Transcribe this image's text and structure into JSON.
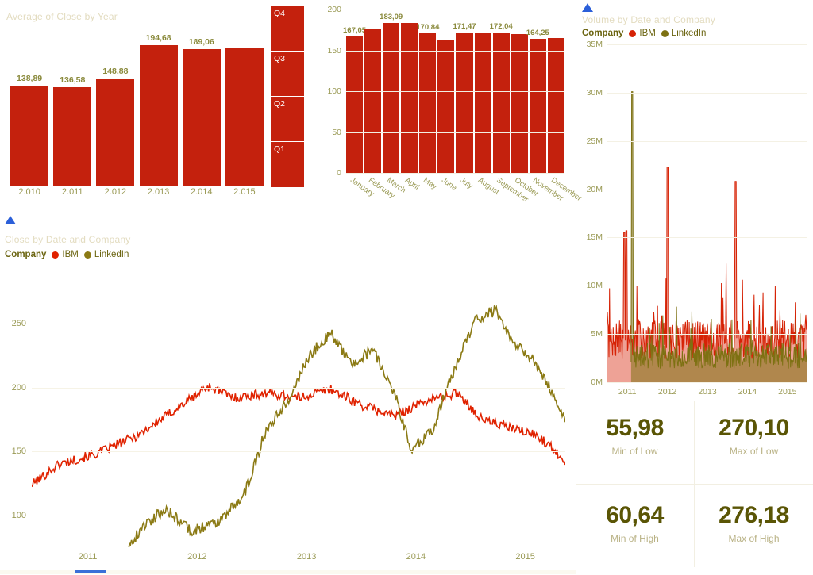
{
  "colors": {
    "ibm_red": "#c4210d",
    "linkedin_olive": "#8b7a14",
    "title_text": "#e3dcc0",
    "axis_text": "#9a9a55",
    "label_text": "#8a8a3c",
    "kpi_value": "#5a5505",
    "kpi_label": "#b9b285",
    "scroll_thumb": "#3a6fd8",
    "filter_arrow": "#2b5fd9"
  },
  "year_chart": {
    "title": "Average of Close by Year",
    "chart_data": {
      "type": "bar",
      "title": "Average of Close by Year",
      "xlabel": "",
      "ylabel": "",
      "categories": [
        "2.010",
        "2.011",
        "2.012",
        "2.013",
        "2.014",
        "2.015"
      ],
      "values": [
        138.89,
        136.58,
        148.88,
        194.68,
        189.06,
        191.5
      ],
      "labels": [
        "138,89",
        "136,58",
        "148,88",
        "194,68",
        "189,06",
        ""
      ],
      "ylim": [
        0,
        220
      ],
      "grid": false
    },
    "quarter_slicer": {
      "segments": [
        "Q4",
        "Q3",
        "Q2",
        "Q1"
      ]
    }
  },
  "month_chart": {
    "chart_data": {
      "type": "bar",
      "title": "",
      "xlabel": "",
      "ylabel": "",
      "categories": [
        "January",
        "February",
        "March",
        "April",
        "May",
        "June",
        "July",
        "August",
        "September",
        "October",
        "November",
        "December"
      ],
      "values": [
        167.05,
        176.5,
        183.09,
        183.2,
        170.84,
        162.5,
        171.47,
        170.6,
        172.04,
        169.8,
        164.25,
        165.0
      ],
      "labels": [
        "167,05",
        "",
        "183,09",
        "",
        "170,84",
        "",
        "171,47",
        "",
        "172,04",
        "",
        "164,25",
        ""
      ],
      "yticks": [
        "0",
        "50",
        "100",
        "150",
        "200"
      ],
      "ylim": [
        0,
        200
      ],
      "grid": true
    }
  },
  "volume_chart": {
    "title": "Volume by Date and Company",
    "legend": {
      "label": "Company",
      "items": [
        {
          "name": "IBM",
          "color": "#d62205"
        },
        {
          "name": "LinkedIn",
          "color": "#7d7112"
        }
      ]
    },
    "chart_data": {
      "type": "area",
      "title": "Volume by Date and Company",
      "xlabel": "",
      "ylabel": "",
      "yticks": [
        "0M",
        "5M",
        "10M",
        "15M",
        "20M",
        "25M",
        "30M",
        "35M"
      ],
      "ylim": [
        0,
        35000000
      ],
      "xticks": [
        "2011",
        "2012",
        "2013",
        "2014",
        "2015"
      ],
      "grid": true,
      "series": [
        {
          "name": "IBM",
          "color": "#d62205",
          "typical": 4500000,
          "peaks": [
            30000000,
            22300000,
            20800000
          ]
        },
        {
          "name": "LinkedIn",
          "color": "#7d7112",
          "typical": 3000000,
          "peaks": [
            30100000
          ]
        }
      ]
    }
  },
  "line_chart": {
    "title": "Close by Date and Company",
    "legend": {
      "label": "Company",
      "items": [
        {
          "name": "IBM",
          "color": "#e02200"
        },
        {
          "name": "LinkedIn",
          "color": "#8b7a14"
        }
      ]
    },
    "chart_data": {
      "type": "line",
      "title": "Close by Date and Company",
      "xlabel": "",
      "ylabel": "",
      "yticks": [
        "100",
        "150",
        "200",
        "250"
      ],
      "ylim": [
        75,
        280
      ],
      "xticks": [
        "2011",
        "2012",
        "2013",
        "2014",
        "2015"
      ],
      "grid": true,
      "series": [
        {
          "name": "IBM",
          "color": "#e02200"
        },
        {
          "name": "LinkedIn",
          "color": "#8b7a14"
        }
      ]
    }
  },
  "kpis": [
    {
      "value": "55,98",
      "label": "Min of Low"
    },
    {
      "value": "270,10",
      "label": "Max of Low"
    },
    {
      "value": "60,64",
      "label": "Min of High"
    },
    {
      "value": "276,18",
      "label": "Max of High"
    }
  ]
}
